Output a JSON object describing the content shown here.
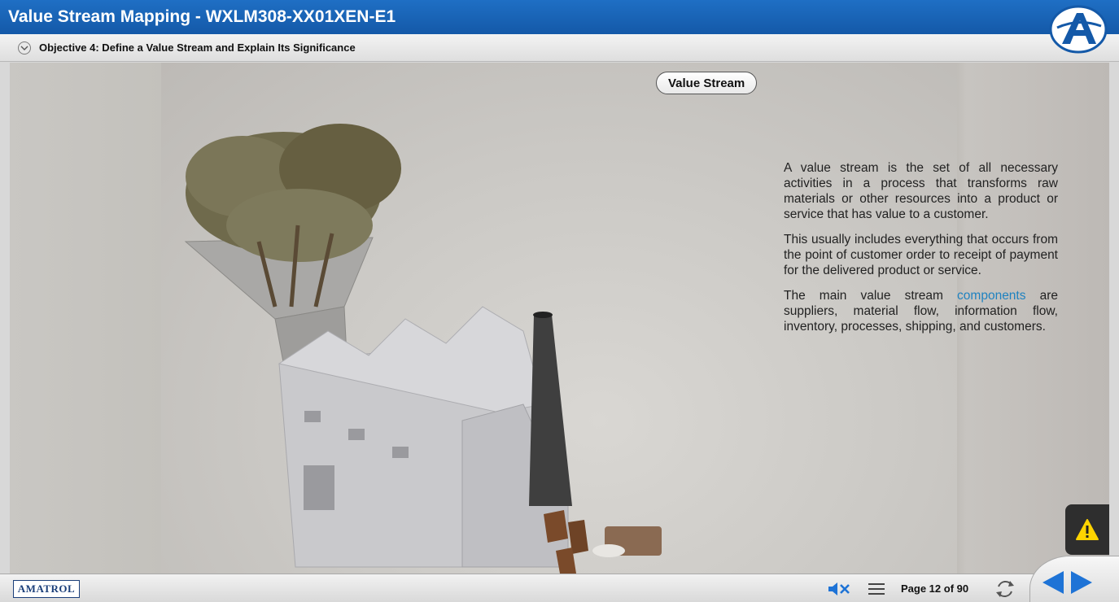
{
  "app": {
    "title": "Value Stream Mapping - WXLM308-XX01XEN-E1",
    "objective": "Objective 4: Define a Value Stream and Explain Its Significance"
  },
  "content": {
    "heading": "Value Stream",
    "paragraph1": "A value stream is the set of all necessary activities in a process that transforms raw materials or other resources into a product or service that has value to a customer.",
    "paragraph2": "This usually includes everything that occurs from the point of customer order to receipt of payment for the delivered product or service.",
    "paragraph3_before": "The main value stream ",
    "paragraph3_link": "components",
    "paragraph3_after": " are suppliers, material flow, information flow, inventory, processes, shipping, and customers."
  },
  "footer": {
    "brand": "AMATROL",
    "page_label": "Page 12 of 90"
  },
  "icons": {
    "objective_toggle": "chevron-down-icon",
    "warning": "warning-icon",
    "mute": "mute-icon",
    "menu": "menu-icon",
    "reload": "reload-icon",
    "prev": "previous-arrow-icon",
    "next": "next-arrow-icon"
  },
  "colors": {
    "title_bar": "#1a64b8",
    "link": "#1f82c0",
    "nav_arrow": "#1e73d6",
    "warning_yellow": "#ffd400"
  }
}
